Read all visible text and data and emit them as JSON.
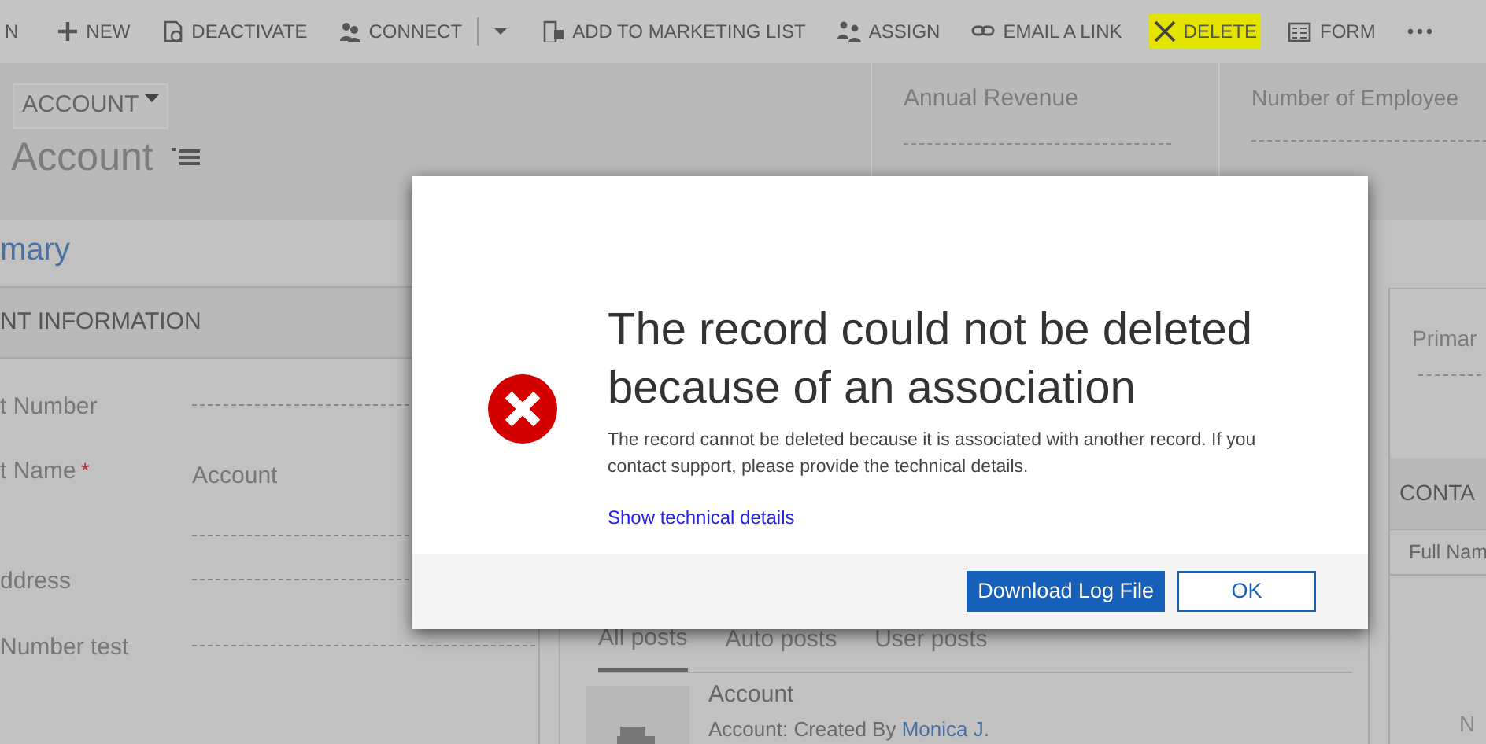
{
  "toolbar": {
    "items": [
      {
        "kind": "button",
        "label": "N",
        "highlighted": false
      },
      {
        "kind": "button",
        "label": "NEW",
        "highlighted": false
      },
      {
        "kind": "button",
        "label": "DEACTIVATE",
        "highlighted": false
      },
      {
        "kind": "button",
        "label": "CONNECT",
        "highlighted": false
      },
      {
        "kind": "split",
        "highlighted": false
      },
      {
        "kind": "button",
        "label": "ADD TO MARKETING LIST",
        "highlighted": false
      },
      {
        "kind": "button",
        "label": "ASSIGN",
        "highlighted": false
      },
      {
        "kind": "button",
        "label": "EMAIL A LINK",
        "highlighted": false
      },
      {
        "kind": "button",
        "label": "DELETE",
        "highlighted": true
      },
      {
        "kind": "button",
        "label": "FORM",
        "highlighted": false
      },
      {
        "kind": "more",
        "highlighted": false
      }
    ]
  },
  "header": {
    "entity_menu": "ACCOUNT",
    "record_name": "Account",
    "fields": [
      {
        "label": "Annual Revenue"
      },
      {
        "label": "Number of Employee"
      }
    ]
  },
  "form_tab": "mary",
  "section": {
    "title": "NT INFORMATION",
    "fields": [
      {
        "label": "t Number"
      },
      {
        "label": "t Name",
        "required_mark": "*",
        "value": "Account"
      },
      {
        "label": "ddress"
      },
      {
        "label": "Number test"
      }
    ]
  },
  "posts": {
    "tabs": [
      {
        "label": "All posts",
        "selected": true
      },
      {
        "label": "Auto posts",
        "selected": false
      },
      {
        "label": "User posts",
        "selected": false
      }
    ],
    "items": [
      {
        "title": "Account",
        "text": "Account: Created By ",
        "author": "Monica J."
      }
    ]
  },
  "side": {
    "field_label": "Primar",
    "section_title": "CONTA",
    "column": "Full Nam",
    "empty_text": "N"
  },
  "dialog": {
    "title": "The record could not be deleted because of an association",
    "message": "The record cannot be deleted because it is associated with another record. If you contact support, please provide the technical details.",
    "link": "Show technical details",
    "buttons": [
      {
        "label": "Download Log File",
        "kind": "primary"
      },
      {
        "label": "OK",
        "kind": "secondary"
      }
    ]
  }
}
